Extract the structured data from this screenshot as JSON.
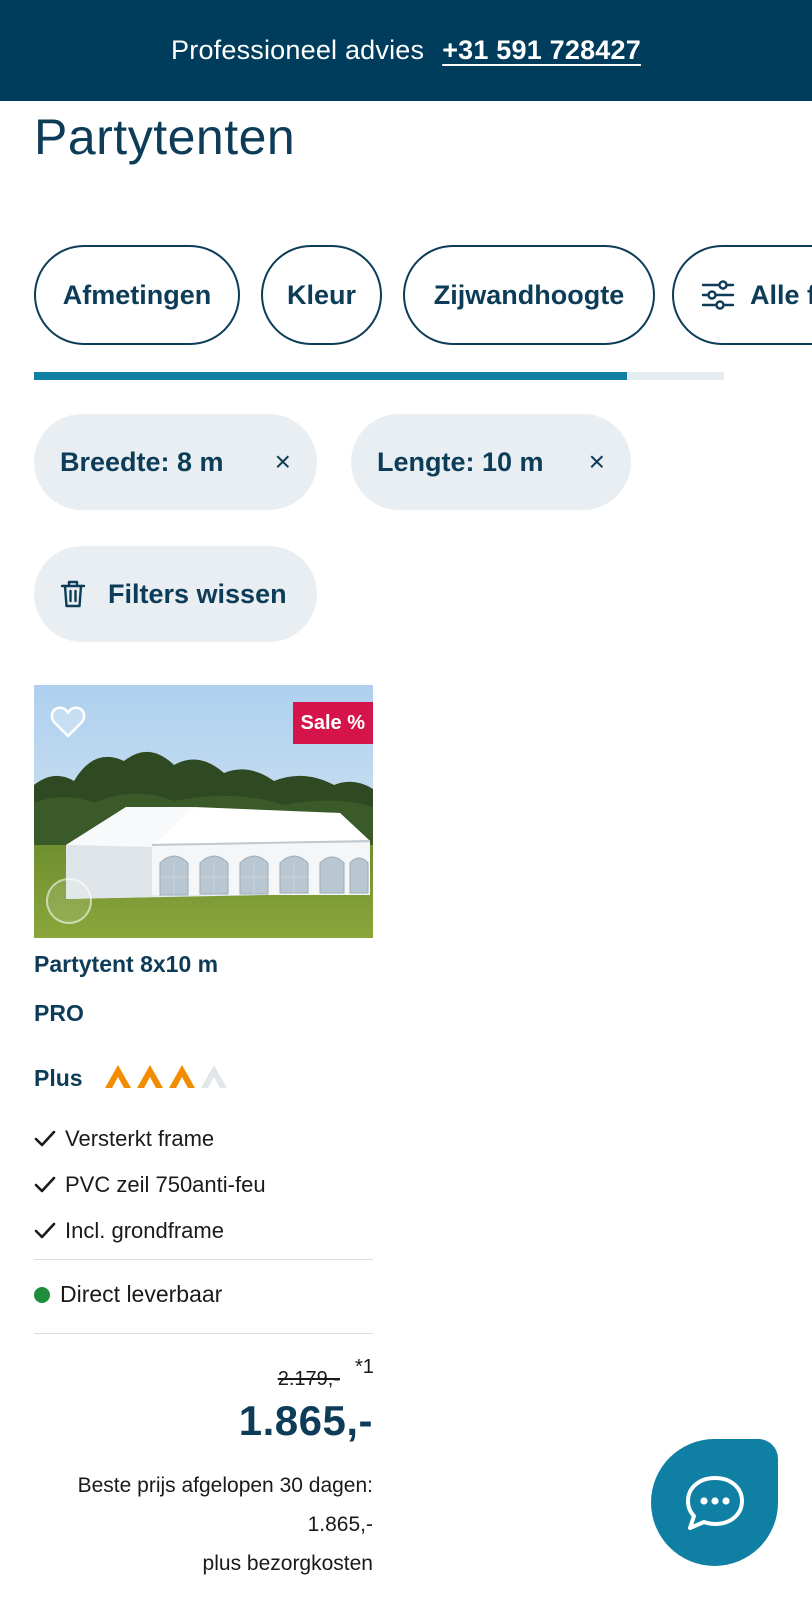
{
  "top_banner": {
    "text": "Professioneel advies",
    "phone": "+31 591 728427"
  },
  "page": {
    "title": "Partytenten"
  },
  "filters": {
    "buttons": [
      "Afmetingen",
      "Kleur",
      "Zijwandhoogte",
      "Alle filters"
    ],
    "progress": 0.86
  },
  "active_filters": {
    "chips": [
      "Breedte: 8 m",
      "Lengte: 10 m"
    ],
    "remove_symbol": "×",
    "clear_label": "Filters wissen"
  },
  "product": {
    "badge": "Sale %",
    "name": "Partytent 8x10 m",
    "line2": "PRO",
    "rating_label": "Plus",
    "rating_value": 3,
    "rating_max": 4,
    "features": [
      "Versterkt frame",
      "PVC zeil 750anti-feu",
      "Incl. grondframe"
    ],
    "stock": "Direct leverbaar",
    "old_price": "2.179,-",
    "old_price_note": "*1",
    "price": "1.865,-",
    "price_note_1": "Beste prijs afgelopen 30 dagen:",
    "price_note_2": "1.865,-",
    "price_note_3": "plus bezorgkosten"
  },
  "colors": {
    "brand_dark": "#003d5c",
    "accent": "#0f7fa3",
    "sale": "#d4144a",
    "rating": "#f28c00",
    "in_stock": "#1e8e3e"
  }
}
